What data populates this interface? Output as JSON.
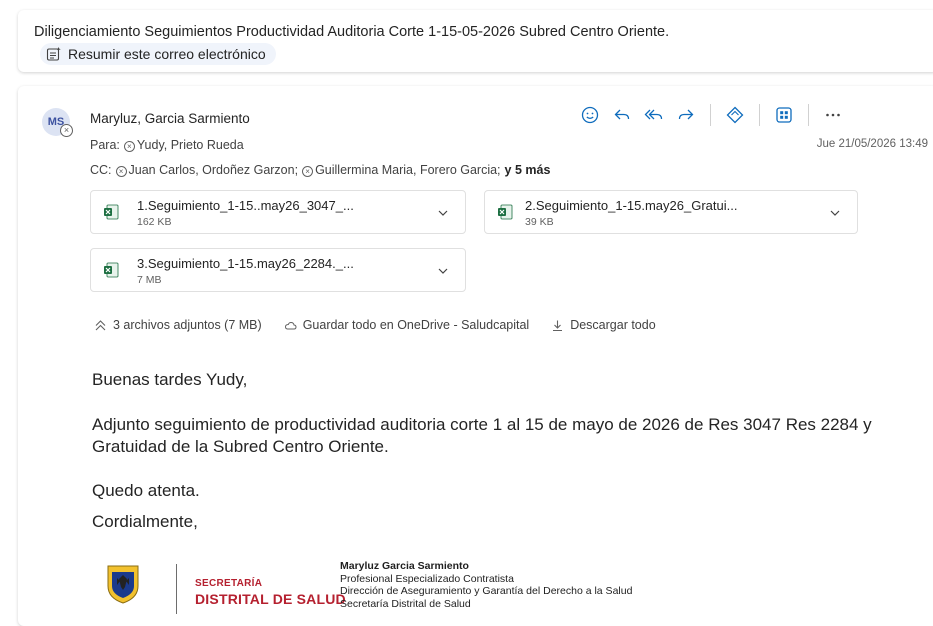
{
  "subject": {
    "title": "Diligenciamiento Seguimientos Productividad Auditoria Corte 1-15-05-2026 Subred Centro Oriente.",
    "summarize_label": "Resumir este correo electrónico"
  },
  "message": {
    "avatar_initials": "MS",
    "sender": "Maryluz, Garcia Sarmiento",
    "to_label": "Para:",
    "to_recipients": [
      "Yudy, Prieto Rueda"
    ],
    "cc_label": "CC:",
    "cc_recipients": [
      "Juan Carlos, Ordoñez Garzon;",
      "Guillermina Maria, Forero Garcia;"
    ],
    "cc_more": "y 5 más",
    "date": "Jue 21/05/2026 13:49",
    "actions": [
      "smiley-icon",
      "reply-icon",
      "reply-all-icon",
      "forward-icon",
      "copilot-icon",
      "apps-icon",
      "more-icon"
    ],
    "attachments": [
      {
        "name": "1.Seguimiento_1-15..may26_3047_...",
        "size": "162 KB",
        "icon": "excel-icon"
      },
      {
        "name": "2.Seguimiento_1-15.may26_Gratui...",
        "size": "39 KB",
        "icon": "excel-icon"
      },
      {
        "name": "3.Seguimiento_1-15.may26_2284._...",
        "size": "7 MB",
        "icon": "excel-icon"
      }
    ],
    "attachments_summary": "3 archivos adjuntos (7 MB)",
    "save_onedrive": "Guardar todo en OneDrive - Saludcapital",
    "download_all": "Descargar todo",
    "body": {
      "greeting": "Buenas tardes Yudy,",
      "paragraph": "Adjunto seguimiento de productividad auditoria corte 1 al 15 de mayo de 2026 de Res 3047 Res 2284 y Gratuidad de la Subred Centro Oriente.",
      "closing": "Quedo atenta.",
      "regards": "Cordialmente,"
    },
    "signature": {
      "logo_line1": "SECRETARÍA",
      "logo_line2": "DISTRITAL DE SALUD",
      "name": "Maryluz Garcia Sarmiento",
      "role": "Profesional Especializado Contratista",
      "department": "Dirección de Aseguramiento y Garantía del Derecho a la Salud",
      "entity": "Secretaría Distrital de Salud"
    }
  },
  "colors": {
    "accent": "#0f6cbd",
    "logo_red": "#b5202f",
    "excel_green": "#1d6f42"
  }
}
